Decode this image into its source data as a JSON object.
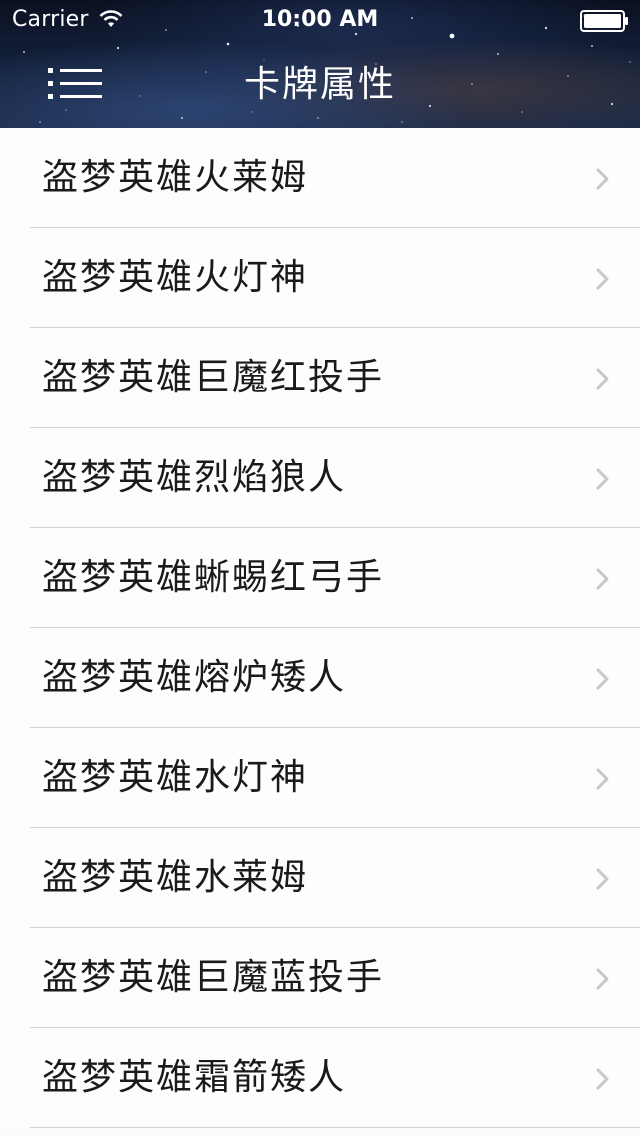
{
  "status_bar": {
    "carrier": "Carrier",
    "time": "10:00 AM",
    "wifi_icon": "wifi-icon",
    "battery_icon": "battery-full-icon"
  },
  "nav": {
    "menu_icon": "hamburger-menu-icon",
    "title": "卡牌属性"
  },
  "list": {
    "items": [
      {
        "label": "盗梦英雄火莱姆"
      },
      {
        "label": "盗梦英雄火灯神"
      },
      {
        "label": "盗梦英雄巨魔红投手"
      },
      {
        "label": "盗梦英雄烈焰狼人"
      },
      {
        "label": "盗梦英雄蜥蜴红弓手"
      },
      {
        "label": "盗梦英雄熔炉矮人"
      },
      {
        "label": "盗梦英雄水灯神"
      },
      {
        "label": "盗梦英雄水莱姆"
      },
      {
        "label": "盗梦英雄巨魔蓝投手"
      },
      {
        "label": "盗梦英雄霜箭矮人"
      }
    ],
    "chevron_icon": "chevron-right-icon"
  },
  "colors": {
    "header_bg": "#15233e",
    "list_bg": "#fbfbfd",
    "separator": "#d4d4d8",
    "chevron": "#c7c7cc",
    "text": "#1a1a1a"
  }
}
